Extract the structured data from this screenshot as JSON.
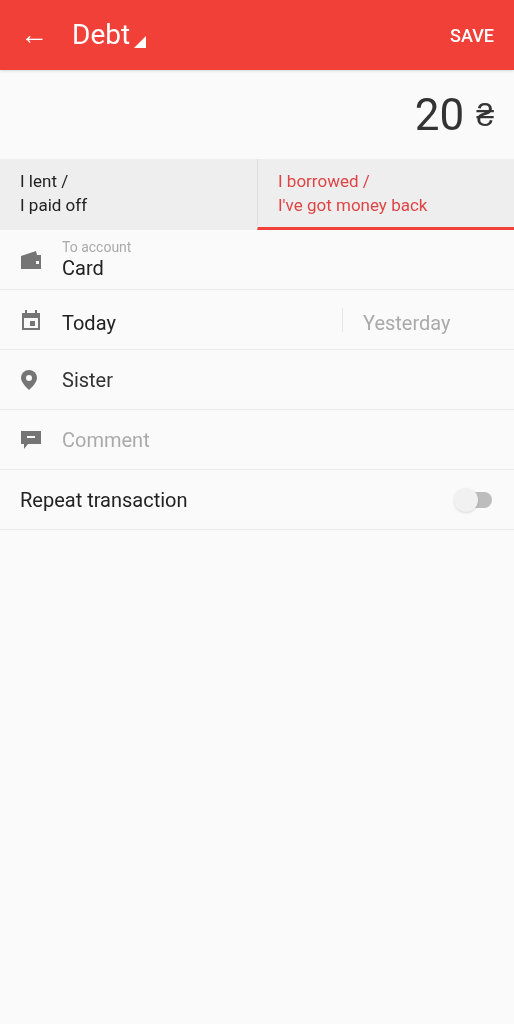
{
  "app_bar": {
    "back": "←",
    "title": "Debt",
    "action": "SAVE"
  },
  "amount": {
    "value": "20",
    "currency": "₴"
  },
  "tabs": [
    {
      "lines": [
        "I lent /",
        "I paid off"
      ],
      "selected": false
    },
    {
      "lines": [
        "I borrowed /",
        "I've got money back"
      ],
      "selected": true
    }
  ],
  "account": {
    "label": "To account",
    "value": "Card"
  },
  "dates": [
    {
      "label": "Today",
      "selected": true
    },
    {
      "label": "Yesterday",
      "selected": false
    }
  ],
  "place": {
    "value": "Sister"
  },
  "comment": {
    "placeholder": "Comment"
  },
  "repeat": {
    "label": "Repeat transaction",
    "on": false
  }
}
